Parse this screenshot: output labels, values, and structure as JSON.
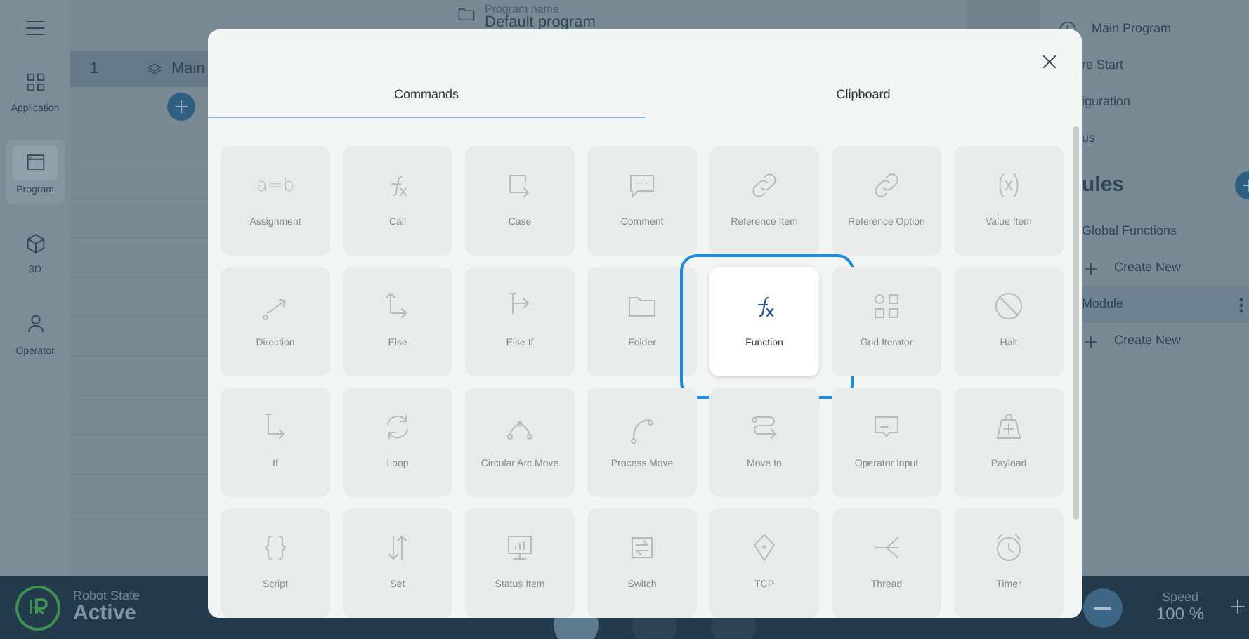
{
  "sidebar": {
    "items": [
      {
        "label": "Application",
        "selected": false
      },
      {
        "label": "Program",
        "selected": true
      },
      {
        "label": "3D",
        "selected": false
      },
      {
        "label": "Operator",
        "selected": false
      }
    ]
  },
  "header": {
    "program_name_label": "Program name",
    "program_name": "Default program"
  },
  "program_rows": [
    {
      "number": "1",
      "name": "Main",
      "selected": true
    }
  ],
  "right_panel": {
    "items": [
      {
        "kind": "program",
        "label": "Main Program",
        "selected": false
      },
      {
        "kind": "entry",
        "label": "re Start",
        "selected": false
      },
      {
        "kind": "entry",
        "label": "iguration",
        "selected": false
      },
      {
        "kind": "entry",
        "label": "us",
        "selected": false
      },
      {
        "kind": "heading",
        "label": "ules",
        "selected": false
      },
      {
        "kind": "entry",
        "label": "Global Functions",
        "selected": false
      },
      {
        "kind": "create",
        "label": "Create New",
        "selected": false
      },
      {
        "kind": "entry",
        "label": "Module",
        "selected": true
      },
      {
        "kind": "create",
        "label": "Create New",
        "selected": false
      }
    ]
  },
  "status_bar": {
    "robot_state_label": "Robot State",
    "robot_state": "Active",
    "speed_label": "Speed",
    "speed": "100 %"
  },
  "dialog": {
    "tabs": [
      {
        "label": "Commands",
        "selected": true
      },
      {
        "label": "Clipboard",
        "selected": false
      }
    ],
    "commands": [
      {
        "label": "Assignment",
        "icon_text": "a=b",
        "selected": false
      },
      {
        "label": "Call",
        "selected": false
      },
      {
        "label": "Case",
        "selected": false
      },
      {
        "label": "Comment",
        "selected": false
      },
      {
        "label": "Reference Item",
        "selected": false
      },
      {
        "label": "Reference Option",
        "selected": false
      },
      {
        "label": "Value Item",
        "selected": false
      },
      {
        "label": "Direction",
        "selected": false
      },
      {
        "label": "Else",
        "selected": false
      },
      {
        "label": "Else If",
        "selected": false
      },
      {
        "label": "Folder",
        "selected": false
      },
      {
        "label": "Function",
        "selected": true
      },
      {
        "label": "Grid Iterator",
        "selected": false
      },
      {
        "label": "Halt",
        "selected": false
      },
      {
        "label": "If",
        "selected": false
      },
      {
        "label": "Loop",
        "selected": false
      },
      {
        "label": "Circular Arc Move",
        "selected": false
      },
      {
        "label": "Process Move",
        "selected": false
      },
      {
        "label": "Move to",
        "selected": false
      },
      {
        "label": "Operator Input",
        "selected": false
      },
      {
        "label": "Payload",
        "selected": false
      },
      {
        "label": "Script",
        "selected": false
      },
      {
        "label": "Set",
        "selected": false
      },
      {
        "label": "Status Item",
        "selected": false
      },
      {
        "label": "Switch",
        "selected": false
      },
      {
        "label": "TCP",
        "selected": false
      },
      {
        "label": "Thread",
        "selected": false
      },
      {
        "label": "Timer",
        "selected": false
      }
    ]
  }
}
